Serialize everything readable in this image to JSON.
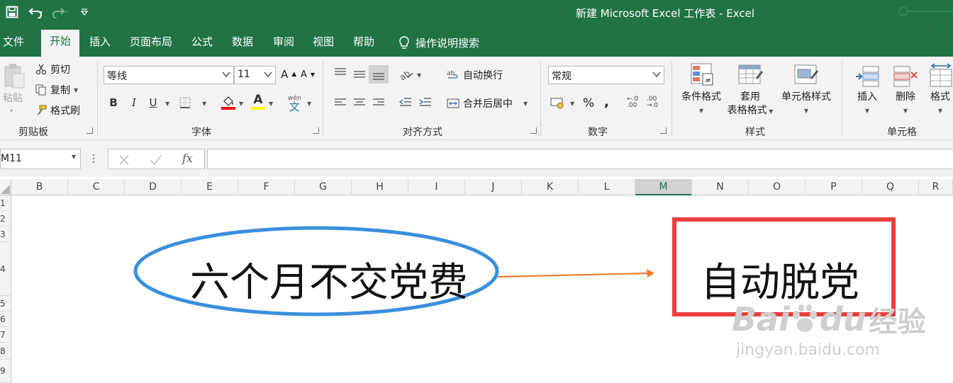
{
  "app": {
    "title": "新建 Microsoft Excel 工作表  -  Excel",
    "brand_color": "#217346"
  },
  "qat": {
    "icons": [
      "save-icon",
      "undo-icon",
      "redo-icon",
      "customize-icon"
    ]
  },
  "tabs": [
    {
      "label": "文件",
      "active": false
    },
    {
      "label": "开始",
      "active": true
    },
    {
      "label": "插入",
      "active": false
    },
    {
      "label": "页面布局",
      "active": false
    },
    {
      "label": "公式",
      "active": false
    },
    {
      "label": "数据",
      "active": false
    },
    {
      "label": "审阅",
      "active": false
    },
    {
      "label": "视图",
      "active": false
    },
    {
      "label": "帮助",
      "active": false
    }
  ],
  "tell_me": "操作说明搜索",
  "clipboard": {
    "paste": "粘贴",
    "cut": "剪切",
    "copy": "复制",
    "format_painter": "格式刷",
    "label": "剪贴板"
  },
  "font": {
    "name": "等线",
    "size": "11",
    "grow": "A",
    "shrink": "A",
    "bold": "B",
    "italic": "I",
    "underline": "U",
    "font_color_glyph": "A",
    "phonetic_glyph": "wén",
    "label": "字体",
    "fill_color": "#ff0000",
    "text_color": "#ffff00"
  },
  "alignment": {
    "wrap_text": "自动换行",
    "merge_center": "合并后居中",
    "label": "对齐方式"
  },
  "number": {
    "format": "常规",
    "percent": "%",
    "comma": ",",
    "increase_decimal": ".00",
    "decrease_decimal": ".0",
    "label": "数字"
  },
  "styles": {
    "conditional": "条件格式",
    "table_line1": "套用",
    "table_line2": "表格格式",
    "cell_styles": "单元格样式",
    "label": "样式"
  },
  "cells": {
    "insert": "插入",
    "delete": "删除",
    "format": "格式",
    "label": "单元格"
  },
  "formula_bar": {
    "name_box": "M11",
    "fx": "fx",
    "formula": ""
  },
  "grid": {
    "columns": [
      "B",
      "C",
      "D",
      "E",
      "F",
      "G",
      "H",
      "I",
      "J",
      "K",
      "L",
      "M",
      "N",
      "O",
      "P",
      "Q",
      "R"
    ],
    "selected_column": "M",
    "rows": [
      "1",
      "2",
      "3",
      "4",
      "5",
      "6",
      "7",
      "8",
      "9"
    ]
  },
  "shapes": {
    "ellipse_text": "六个月不交党费",
    "rect_text": "自动脱党",
    "ellipse_color": "#3a8fdc",
    "arrow_color": "#ed7d31",
    "rect_color": "#ea3e3e"
  },
  "watermark": {
    "brand": "Bai",
    "brand2": "du",
    "cn": "经验",
    "url": "jingyan.baidu.com"
  }
}
